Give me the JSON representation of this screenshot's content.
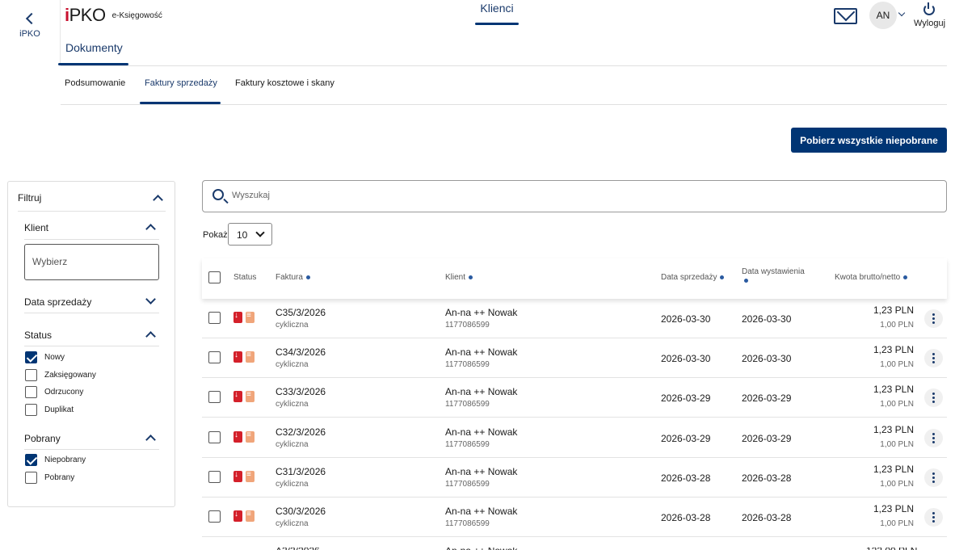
{
  "back": {
    "label": "iPKO"
  },
  "brand": {
    "logo_prefix": "i",
    "logo_main": "PKO",
    "product": "e-Księgowość"
  },
  "header": {
    "section_tab": "Dokumenty",
    "center_tab": "Klienci",
    "avatar_initials": "AN",
    "logout_label": "Wyloguj"
  },
  "subtabs": [
    "Podsumowanie",
    "Faktury sprzedaży",
    "Faktury kosztowe i skany"
  ],
  "download_all_button": "Pobierz wszystkie niepobrane",
  "filter": {
    "title": "Filtruj",
    "client": {
      "label": "Klient",
      "placeholder": "Wybierz"
    },
    "sale_date": {
      "label": "Data sprzedaży"
    },
    "status": {
      "label": "Status",
      "options": [
        {
          "label": "Nowy",
          "checked": true
        },
        {
          "label": "Zaksięgowany",
          "checked": false
        },
        {
          "label": "Odrzucony",
          "checked": false
        },
        {
          "label": "Duplikat",
          "checked": false
        }
      ]
    },
    "downloaded": {
      "label": "Pobrany",
      "options": [
        {
          "label": "Niepobrany",
          "checked": true
        },
        {
          "label": "Pobrany",
          "checked": false
        }
      ]
    }
  },
  "search": {
    "placeholder": "Wyszukaj"
  },
  "page_size": {
    "label": "Pokaż",
    "value": "10"
  },
  "table": {
    "headers": {
      "status": "Status",
      "invoice": "Faktura",
      "client": "Klient",
      "sale_date": "Data sprzedaży",
      "issue_date_1": "Data wystawienia",
      "amount": "Kwota brutto/netto"
    },
    "rows": [
      {
        "invoice": "C35/3/2026",
        "type": "cykliczna",
        "client": "An-na ++ Nowak",
        "nip": "1177086599",
        "sale_date": "2026-03-30",
        "issue_date": "2026-03-30",
        "gross": "1,23 PLN",
        "net": "1,00 PLN"
      },
      {
        "invoice": "C34/3/2026",
        "type": "cykliczna",
        "client": "An-na ++ Nowak",
        "nip": "1177086599",
        "sale_date": "2026-03-30",
        "issue_date": "2026-03-30",
        "gross": "1,23 PLN",
        "net": "1,00 PLN"
      },
      {
        "invoice": "C33/3/2026",
        "type": "cykliczna",
        "client": "An-na ++ Nowak",
        "nip": "1177086599",
        "sale_date": "2026-03-29",
        "issue_date": "2026-03-29",
        "gross": "1,23 PLN",
        "net": "1,00 PLN"
      },
      {
        "invoice": "C32/3/2026",
        "type": "cykliczna",
        "client": "An-na ++ Nowak",
        "nip": "1177086599",
        "sale_date": "2026-03-29",
        "issue_date": "2026-03-29",
        "gross": "1,23 PLN",
        "net": "1,00 PLN"
      },
      {
        "invoice": "C31/3/2026",
        "type": "cykliczna",
        "client": "An-na ++ Nowak",
        "nip": "1177086599",
        "sale_date": "2026-03-28",
        "issue_date": "2026-03-28",
        "gross": "1,23 PLN",
        "net": "1,00 PLN"
      },
      {
        "invoice": "C30/3/2026",
        "type": "cykliczna",
        "client": "An-na ++ Nowak",
        "nip": "1177086599",
        "sale_date": "2026-03-28",
        "issue_date": "2026-03-28",
        "gross": "1,23 PLN",
        "net": "1,00 PLN"
      }
    ]
  },
  "colors": {
    "brand_navy": "#003574",
    "pdf_red": "#d4202a",
    "doc_orange": "#f0a57a"
  }
}
